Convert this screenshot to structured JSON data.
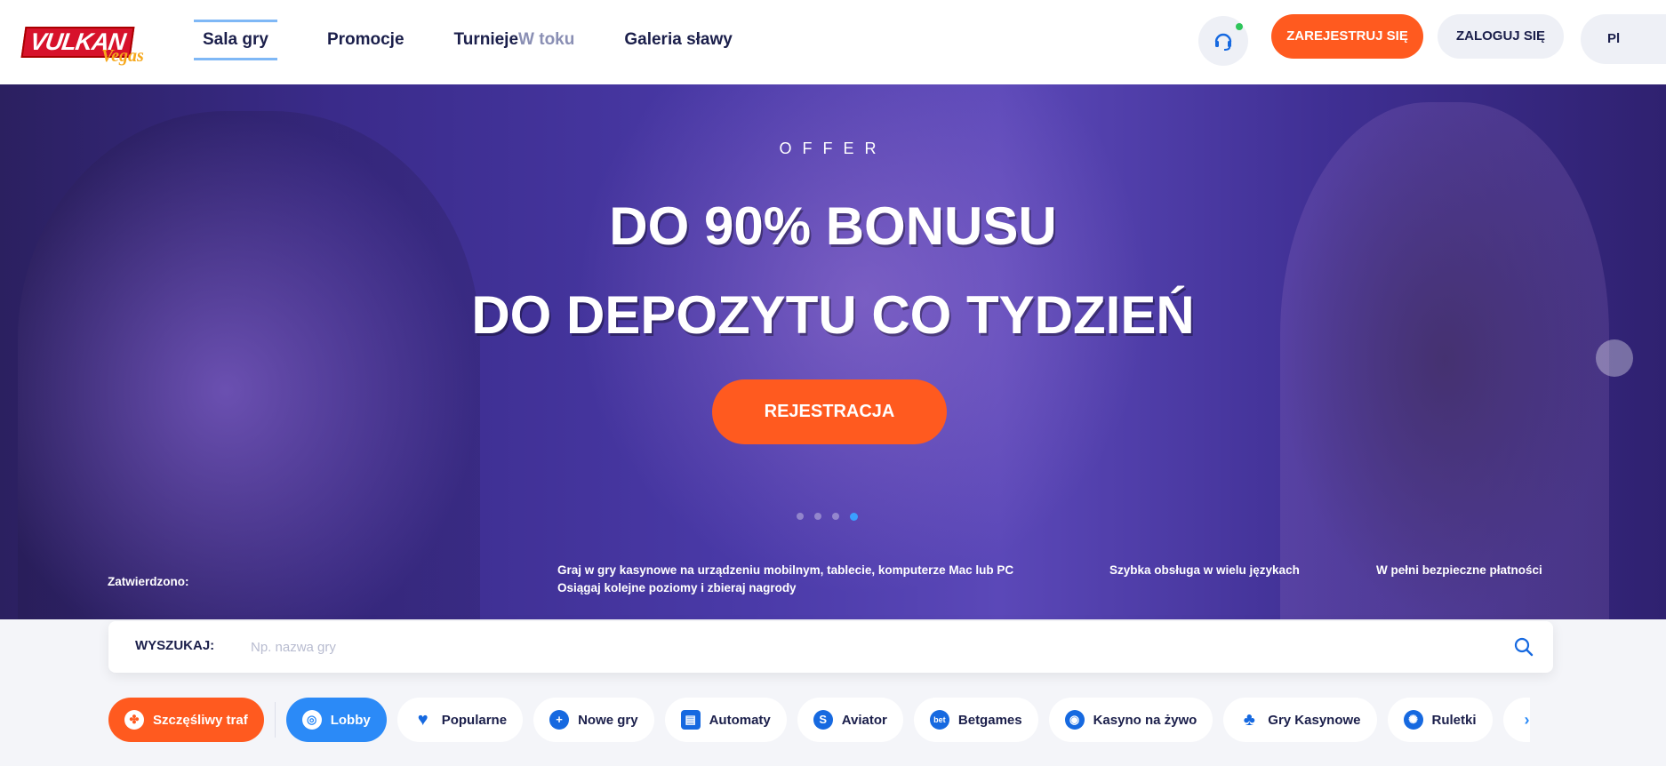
{
  "header": {
    "logo_text": "VULKAN Vegas",
    "nav": [
      {
        "label": "Sala gry",
        "active": true
      },
      {
        "label": "Promocje"
      },
      {
        "label": "Turnieje",
        "badge": "W toku"
      },
      {
        "label": "Galeria sławy"
      }
    ],
    "register_label": "ZAREJESTRUJ SIĘ",
    "login_label": "ZALOGUJ SIĘ",
    "language": "Pl"
  },
  "banner": {
    "kicker": "OFFER",
    "title_line1": "DO 90% BONUSU",
    "title_line2": "DO DEPOZYTU CO TYDZIEŃ",
    "cta_label": "REJESTRACJA",
    "slides_total": 4,
    "active_slide": 4,
    "features": {
      "approved": "Zatwierdzono:",
      "devices_line1": "Graj w gry kasynowe na urządzeniu mobilnym, tablecie, komputerze Mac lub PC",
      "devices_line2": "Osiągaj kolejne poziomy i zbieraj nagrody",
      "languages": "Szybka obsługa w wielu językach",
      "payments": "W pełni bezpieczne płatności"
    }
  },
  "search": {
    "label": "WYSZUKAJ:",
    "placeholder": "Np. nazwa gry",
    "value": ""
  },
  "categories": [
    {
      "label": "Szczęśliwy traf",
      "icon": "clover-icon"
    },
    {
      "label": "Lobby",
      "icon": "medal-icon"
    },
    {
      "label": "Popularne",
      "icon": "heart-icon"
    },
    {
      "label": "Nowe gry",
      "icon": "plus-icon"
    },
    {
      "label": "Automaty",
      "icon": "slot-machine-icon"
    },
    {
      "label": "Aviator",
      "icon": "aviator-icon"
    },
    {
      "label": "Betgames",
      "icon": "betgames-icon"
    },
    {
      "label": "Kasyno na żywo",
      "icon": "live-casino-icon"
    },
    {
      "label": "Gry Kasynowe",
      "icon": "club-icon"
    },
    {
      "label": "Ruletki",
      "icon": "roulette-icon"
    }
  ],
  "colors": {
    "accent": "#ff5a1f",
    "primary": "#2b8af7",
    "text": "#1b1f4b"
  }
}
